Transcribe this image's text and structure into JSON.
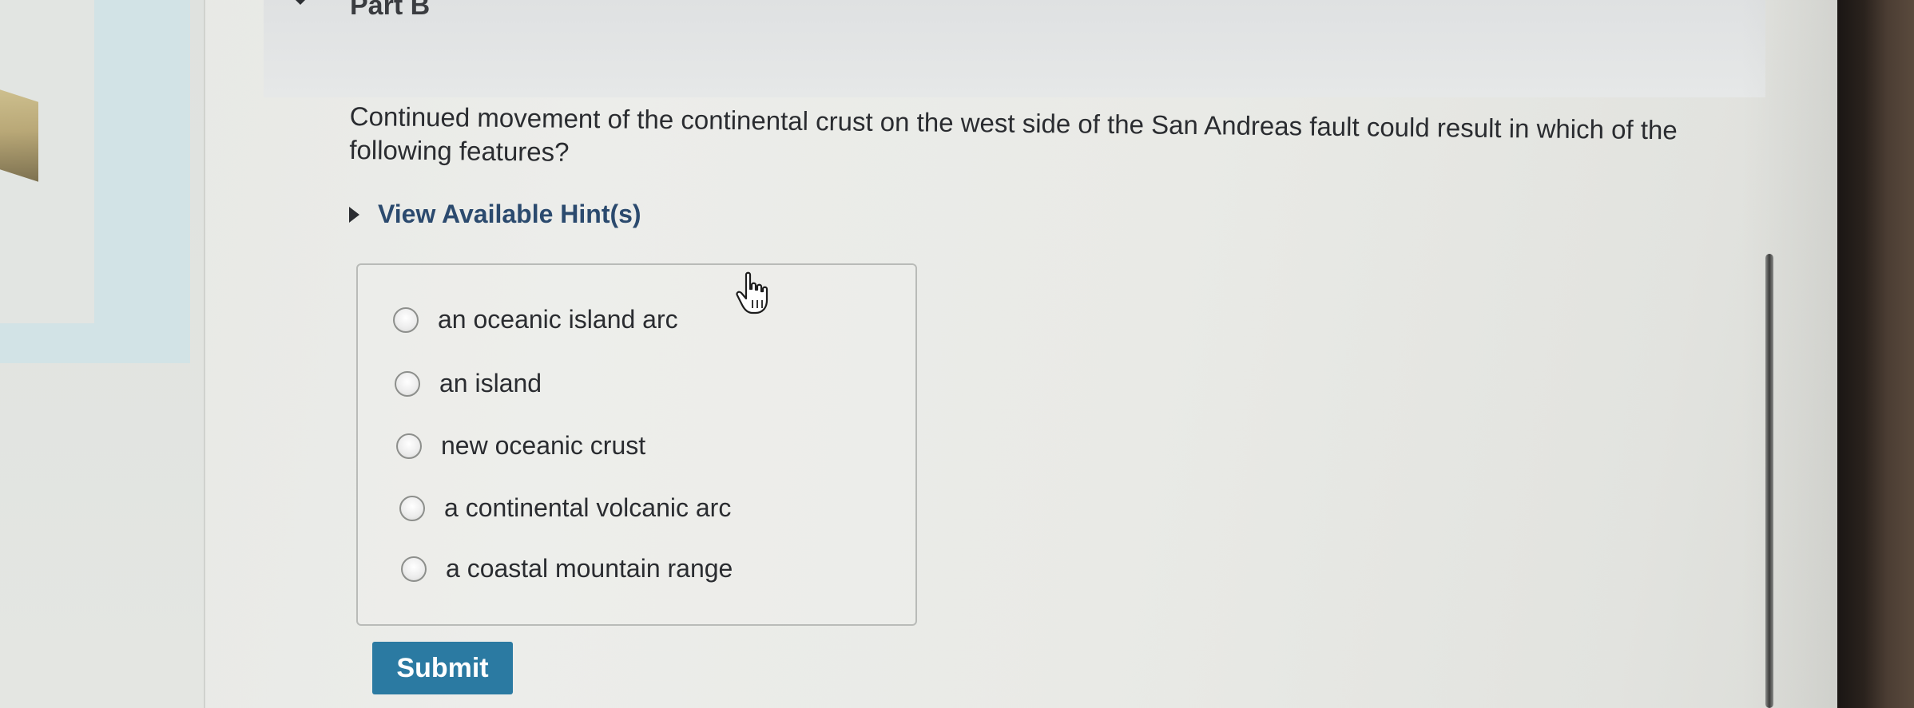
{
  "header": {
    "part_title": "Part B"
  },
  "question": {
    "text": "Continued movement of the continental crust on the west side of the San Andreas fault could result in which of the following features?"
  },
  "hint": {
    "label": "View Available Hint(s)"
  },
  "options": [
    {
      "label": "an oceanic island arc"
    },
    {
      "label": "an island"
    },
    {
      "label": "new oceanic crust"
    },
    {
      "label": "a continental volcanic arc"
    },
    {
      "label": "a coastal mountain range"
    }
  ],
  "submit": {
    "label": "Submit"
  },
  "colors": {
    "submit_bg": "#2b7aa2",
    "hint_text": "#2b4a6e"
  },
  "icons": {
    "header_caret": "caret-down-icon",
    "hint_caret": "caret-right-icon",
    "cursor": "hand-pointer-icon"
  }
}
